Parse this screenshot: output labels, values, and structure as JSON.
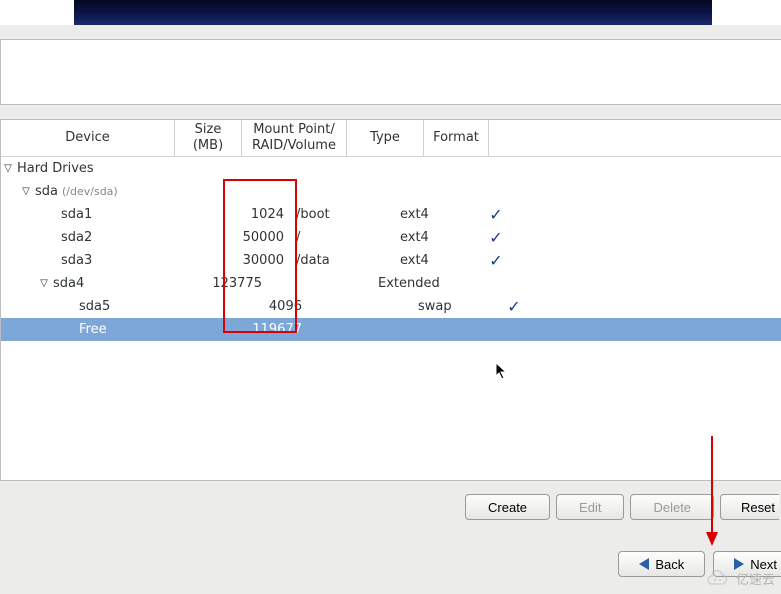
{
  "columns": {
    "device": "Device",
    "size": "Size\n(MB)",
    "mount": "Mount Point/\nRAID/Volume",
    "type": "Type",
    "format": "Format"
  },
  "tree": {
    "root_label": "Hard Drives",
    "disk": {
      "name": "sda",
      "path": "(/dev/sda)"
    },
    "rows": [
      {
        "dev": "sda1",
        "size": "1024",
        "mount": "/boot",
        "type": "ext4",
        "fmt": true
      },
      {
        "dev": "sda2",
        "size": "50000",
        "mount": "/",
        "type": "ext4",
        "fmt": true
      },
      {
        "dev": "sda3",
        "size": "30000",
        "mount": "/data",
        "type": "ext4",
        "fmt": true
      },
      {
        "dev": "sda4",
        "size": "123775",
        "mount": "",
        "type": "Extended",
        "fmt": false,
        "expand": true
      },
      {
        "dev": "sda5",
        "size": "4096",
        "mount": "",
        "type": "swap",
        "fmt": true,
        "child": true
      },
      {
        "dev": "Free",
        "size": "119677",
        "mount": "",
        "type": "",
        "fmt": false,
        "child": true,
        "selected": true
      }
    ]
  },
  "toolbar": {
    "create": "Create",
    "edit": "Edit",
    "delete": "Delete",
    "reset": "Reset"
  },
  "nav": {
    "back": "Back",
    "next": "Next"
  },
  "watermark": "亿速云"
}
